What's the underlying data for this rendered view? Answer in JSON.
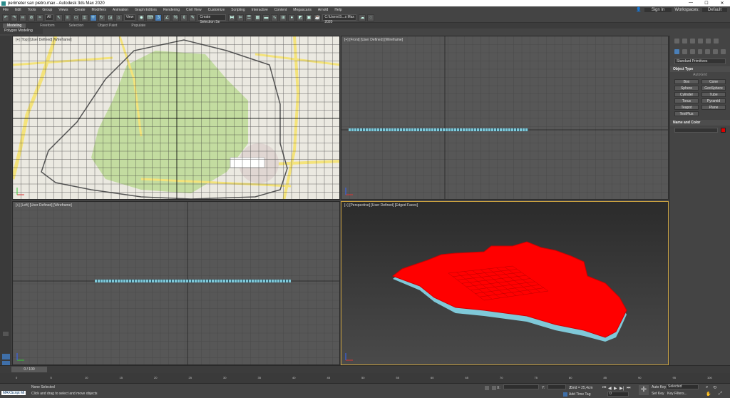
{
  "window": {
    "title": "perimeter san pietro.max - Autodesk 3ds Max 2020"
  },
  "menu": [
    "File",
    "Edit",
    "Tools",
    "Group",
    "Views",
    "Create",
    "Modifiers",
    "Animation",
    "Graph Editors",
    "Rendering",
    "Civil View",
    "Customize",
    "Scripting",
    "Interactive",
    "Content",
    "Megascans",
    "Arnold",
    "Help"
  ],
  "menu_right": {
    "sign_in": "Sign In",
    "workspaces_label": "Workspaces:",
    "workspace_value": "Default"
  },
  "toolbar": {
    "selection_filter": "All",
    "ref_coord": "View",
    "named_sel": "Create Selection Se",
    "path": "C:\\Users\\S...s Max 2020"
  },
  "ribbon": {
    "tabs": [
      "Modeling",
      "Freeform",
      "Selection",
      "Object Paint",
      "Populate"
    ],
    "sub": "Polygon Modeling"
  },
  "viewports": {
    "top": "[+] [Top] [User Defined] [Wireframe]",
    "front": "[+] [Front] [User Defined] [Wireframe]",
    "left": "[+] [Left] [User Defined] [Wireframe]",
    "perspective": "[+] [Perspective] [User Defined] [Edged Faces]"
  },
  "command_panel": {
    "category": "Standard Primitives",
    "object_type_title": "Object Type",
    "autogrid": "AutoGrid",
    "objects": [
      "Box",
      "Cone",
      "Sphere",
      "GeoSphere",
      "Cylinder",
      "Tube",
      "Torus",
      "Pyramid",
      "Teapot",
      "Plane",
      "TextPlus"
    ],
    "name_color_title": "Name and Color",
    "object_color": "#e00000"
  },
  "timeline": {
    "frame": "0 / 100",
    "ticks": [
      "0",
      "5",
      "10",
      "15",
      "20",
      "25",
      "30",
      "35",
      "40",
      "45",
      "50",
      "55",
      "60",
      "65",
      "70",
      "75",
      "80",
      "85",
      "90",
      "95",
      "100"
    ]
  },
  "status": {
    "maxscript": "MAXScript Mi",
    "selection": "None Selected",
    "prompt": "Click and drag to select and move objects",
    "x_label": "X:",
    "y_label": "Y:",
    "z_label": "Z:",
    "grid": "Grid = 25,4cm",
    "add_time_tag": "Add Time Tag",
    "auto_key": "Auto Key",
    "set_key": "Set Key",
    "selected": "Selected",
    "key_filters": "Key Filters...",
    "frame_field": "0"
  },
  "colors": {
    "accent": "#4a7fb8",
    "object_red": "#ff0000",
    "edge_cyan": "#7fc8d8"
  }
}
